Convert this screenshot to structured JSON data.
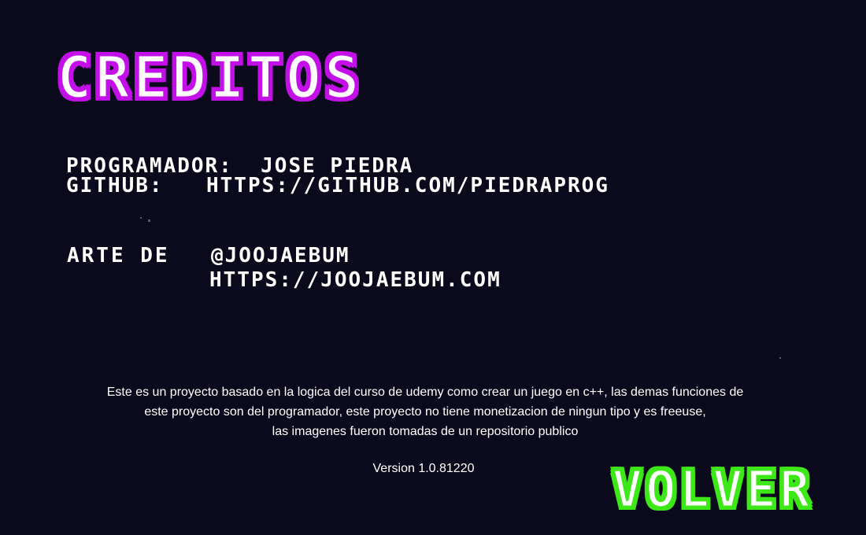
{
  "screen": {
    "title": "CREDITOS",
    "colors": {
      "background": "#0b0a1c",
      "title_outline": "#c410e8",
      "button_outline": "#3ee818",
      "text": "#ffffff"
    }
  },
  "credits": {
    "programmer_line": "PROGRAMADOR:  JOSE PIEDRA",
    "github_label": "GITHUB:",
    "github_url": "HTTPS://GITHUB.COM/PIEDRAPROG",
    "art_label": "ARTE DE",
    "art_handle": "@JOOJAEBUM",
    "art_url": "HTTPS://JOOJAEBUM.COM"
  },
  "disclaimer": {
    "lines": [
      "Este es un proyecto basado en la logica del curso de udemy como crear un juego en c++, las demas funciones de",
      "este proyecto son del programador, este proyecto no tiene monetizacion de ningun tipo y es freeuse,",
      "las imagenes fueron tomadas de un repositorio publico"
    ],
    "version": "Version 1.0.81220"
  },
  "buttons": {
    "back_label": "VOLVER"
  }
}
